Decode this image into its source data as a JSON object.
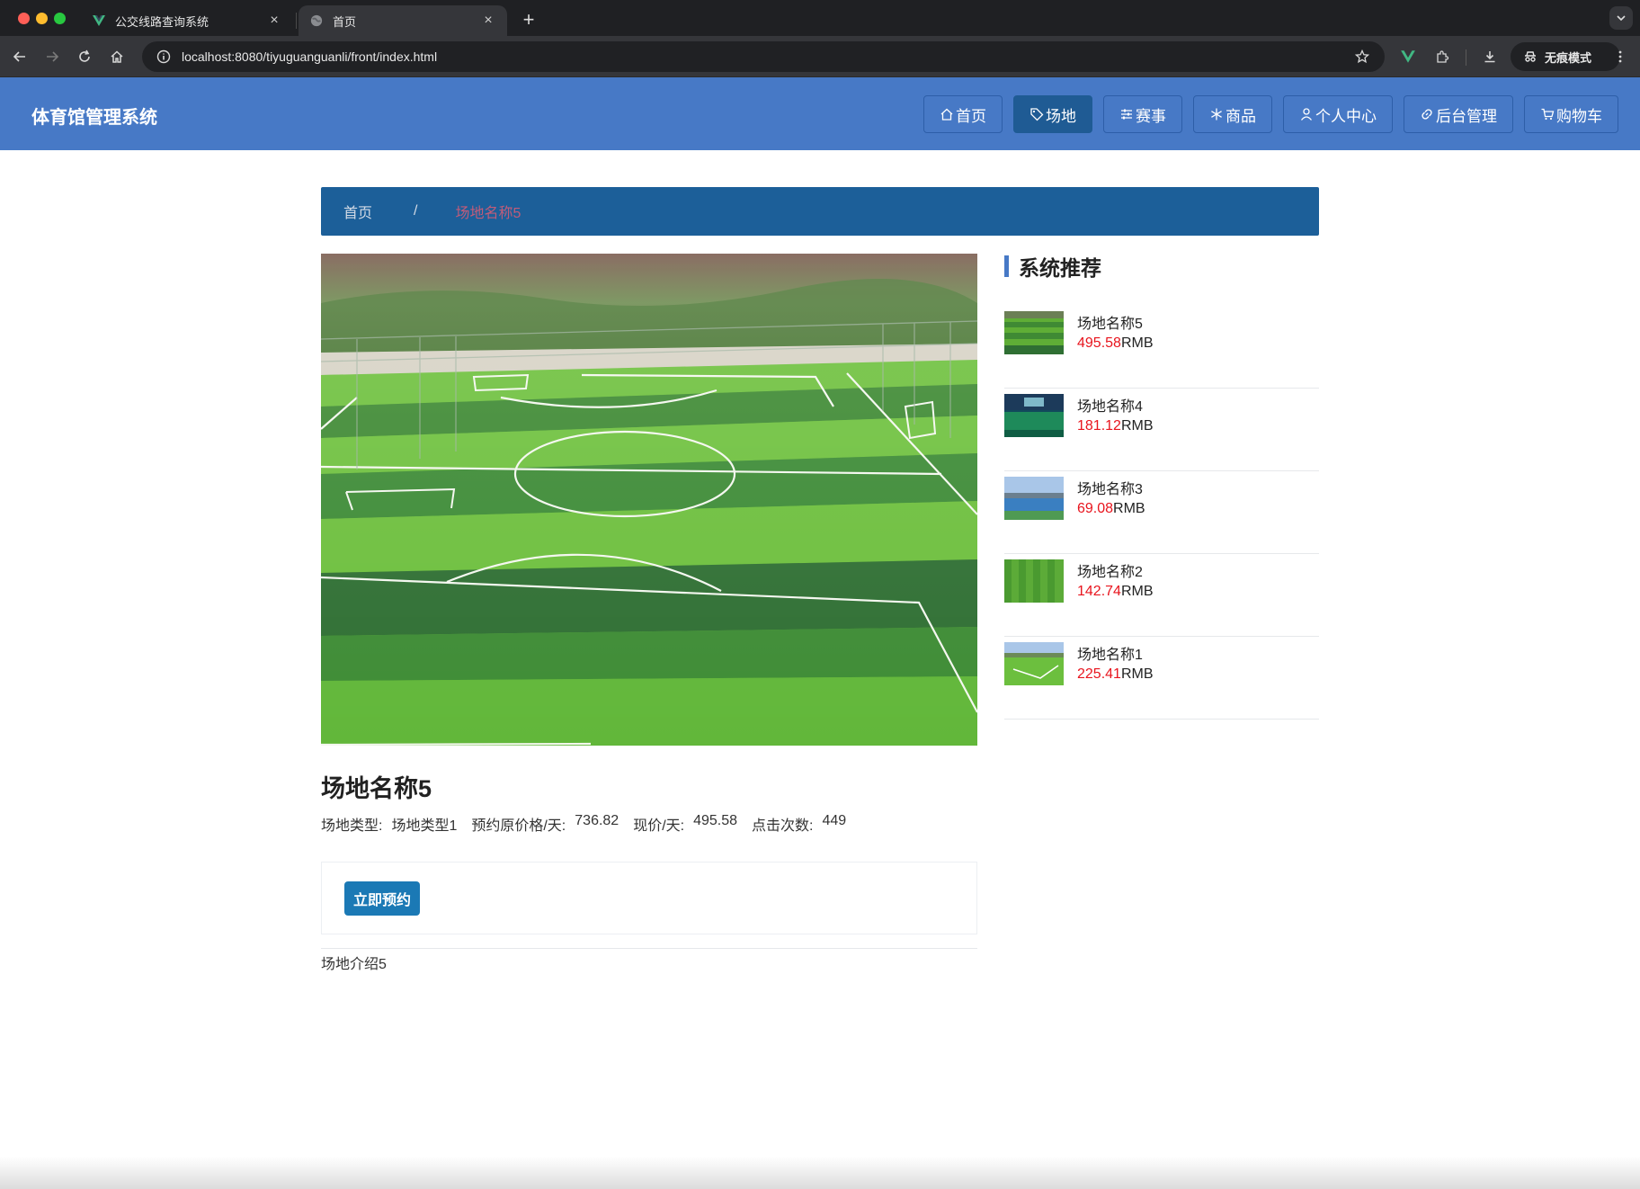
{
  "browser": {
    "tabs": [
      {
        "title": "公交线路查询系统",
        "favicon": "vue-icon"
      },
      {
        "title": "首页",
        "favicon": "globe-icon",
        "active": true
      }
    ],
    "url": "localhost:8080/tiyuguanguanli/front/index.html",
    "incognito_label": "无痕模式"
  },
  "site": {
    "brand": "体育馆管理系统",
    "nav": [
      {
        "label": "首页",
        "icon": "home-icon"
      },
      {
        "label": "场地",
        "icon": "tag-icon",
        "active": true
      },
      {
        "label": "赛事",
        "icon": "sliders-icon"
      },
      {
        "label": "商品",
        "icon": "snowflake-icon"
      },
      {
        "label": "个人中心",
        "icon": "user-icon"
      },
      {
        "label": "后台管理",
        "icon": "link-icon"
      },
      {
        "label": "购物车",
        "icon": "cart-icon"
      }
    ]
  },
  "breadcrumb": {
    "home": "首页",
    "separator": "/",
    "current": "场地名称5"
  },
  "detail": {
    "title": "场地名称5",
    "meta": [
      {
        "label": "场地类型:",
        "value": "场地类型1"
      },
      {
        "label": "预约原价格/天:",
        "value": "736.82"
      },
      {
        "label": "现价/天:",
        "value": "495.58"
      },
      {
        "label": "点击次数:",
        "value": "449"
      }
    ],
    "book_label": "立即预约",
    "intro": "场地介绍5"
  },
  "sidebar": {
    "title": "系统推荐",
    "items": [
      {
        "name": "场地名称5",
        "price": "495.58",
        "unit": "RMB"
      },
      {
        "name": "场地名称4",
        "price": "181.12",
        "unit": "RMB"
      },
      {
        "name": "场地名称3",
        "price": "69.08",
        "unit": "RMB"
      },
      {
        "name": "场地名称2",
        "price": "142.74",
        "unit": "RMB"
      },
      {
        "name": "场地名称1",
        "price": "225.41",
        "unit": "RMB"
      }
    ]
  },
  "colors": {
    "navbar": "#4779c6",
    "active_nav": "#1f5b94",
    "breadcrumb_bg": "#1c5f99",
    "price": "#e8141d",
    "button": "#1b79b5"
  }
}
